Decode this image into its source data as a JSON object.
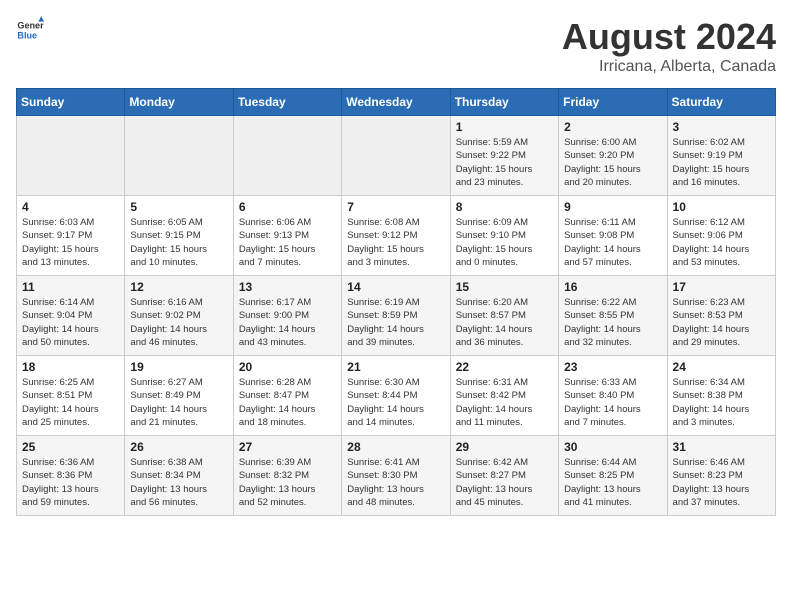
{
  "header": {
    "logo_general": "General",
    "logo_blue": "Blue",
    "title": "August 2024",
    "subtitle": "Irricana, Alberta, Canada"
  },
  "weekdays": [
    "Sunday",
    "Monday",
    "Tuesday",
    "Wednesday",
    "Thursday",
    "Friday",
    "Saturday"
  ],
  "weeks": [
    [
      {
        "day": "",
        "info": ""
      },
      {
        "day": "",
        "info": ""
      },
      {
        "day": "",
        "info": ""
      },
      {
        "day": "",
        "info": ""
      },
      {
        "day": "1",
        "info": "Sunrise: 5:59 AM\nSunset: 9:22 PM\nDaylight: 15 hours\nand 23 minutes."
      },
      {
        "day": "2",
        "info": "Sunrise: 6:00 AM\nSunset: 9:20 PM\nDaylight: 15 hours\nand 20 minutes."
      },
      {
        "day": "3",
        "info": "Sunrise: 6:02 AM\nSunset: 9:19 PM\nDaylight: 15 hours\nand 16 minutes."
      }
    ],
    [
      {
        "day": "4",
        "info": "Sunrise: 6:03 AM\nSunset: 9:17 PM\nDaylight: 15 hours\nand 13 minutes."
      },
      {
        "day": "5",
        "info": "Sunrise: 6:05 AM\nSunset: 9:15 PM\nDaylight: 15 hours\nand 10 minutes."
      },
      {
        "day": "6",
        "info": "Sunrise: 6:06 AM\nSunset: 9:13 PM\nDaylight: 15 hours\nand 7 minutes."
      },
      {
        "day": "7",
        "info": "Sunrise: 6:08 AM\nSunset: 9:12 PM\nDaylight: 15 hours\nand 3 minutes."
      },
      {
        "day": "8",
        "info": "Sunrise: 6:09 AM\nSunset: 9:10 PM\nDaylight: 15 hours\nand 0 minutes."
      },
      {
        "day": "9",
        "info": "Sunrise: 6:11 AM\nSunset: 9:08 PM\nDaylight: 14 hours\nand 57 minutes."
      },
      {
        "day": "10",
        "info": "Sunrise: 6:12 AM\nSunset: 9:06 PM\nDaylight: 14 hours\nand 53 minutes."
      }
    ],
    [
      {
        "day": "11",
        "info": "Sunrise: 6:14 AM\nSunset: 9:04 PM\nDaylight: 14 hours\nand 50 minutes."
      },
      {
        "day": "12",
        "info": "Sunrise: 6:16 AM\nSunset: 9:02 PM\nDaylight: 14 hours\nand 46 minutes."
      },
      {
        "day": "13",
        "info": "Sunrise: 6:17 AM\nSunset: 9:00 PM\nDaylight: 14 hours\nand 43 minutes."
      },
      {
        "day": "14",
        "info": "Sunrise: 6:19 AM\nSunset: 8:59 PM\nDaylight: 14 hours\nand 39 minutes."
      },
      {
        "day": "15",
        "info": "Sunrise: 6:20 AM\nSunset: 8:57 PM\nDaylight: 14 hours\nand 36 minutes."
      },
      {
        "day": "16",
        "info": "Sunrise: 6:22 AM\nSunset: 8:55 PM\nDaylight: 14 hours\nand 32 minutes."
      },
      {
        "day": "17",
        "info": "Sunrise: 6:23 AM\nSunset: 8:53 PM\nDaylight: 14 hours\nand 29 minutes."
      }
    ],
    [
      {
        "day": "18",
        "info": "Sunrise: 6:25 AM\nSunset: 8:51 PM\nDaylight: 14 hours\nand 25 minutes."
      },
      {
        "day": "19",
        "info": "Sunrise: 6:27 AM\nSunset: 8:49 PM\nDaylight: 14 hours\nand 21 minutes."
      },
      {
        "day": "20",
        "info": "Sunrise: 6:28 AM\nSunset: 8:47 PM\nDaylight: 14 hours\nand 18 minutes."
      },
      {
        "day": "21",
        "info": "Sunrise: 6:30 AM\nSunset: 8:44 PM\nDaylight: 14 hours\nand 14 minutes."
      },
      {
        "day": "22",
        "info": "Sunrise: 6:31 AM\nSunset: 8:42 PM\nDaylight: 14 hours\nand 11 minutes."
      },
      {
        "day": "23",
        "info": "Sunrise: 6:33 AM\nSunset: 8:40 PM\nDaylight: 14 hours\nand 7 minutes."
      },
      {
        "day": "24",
        "info": "Sunrise: 6:34 AM\nSunset: 8:38 PM\nDaylight: 14 hours\nand 3 minutes."
      }
    ],
    [
      {
        "day": "25",
        "info": "Sunrise: 6:36 AM\nSunset: 8:36 PM\nDaylight: 13 hours\nand 59 minutes."
      },
      {
        "day": "26",
        "info": "Sunrise: 6:38 AM\nSunset: 8:34 PM\nDaylight: 13 hours\nand 56 minutes."
      },
      {
        "day": "27",
        "info": "Sunrise: 6:39 AM\nSunset: 8:32 PM\nDaylight: 13 hours\nand 52 minutes."
      },
      {
        "day": "28",
        "info": "Sunrise: 6:41 AM\nSunset: 8:30 PM\nDaylight: 13 hours\nand 48 minutes."
      },
      {
        "day": "29",
        "info": "Sunrise: 6:42 AM\nSunset: 8:27 PM\nDaylight: 13 hours\nand 45 minutes."
      },
      {
        "day": "30",
        "info": "Sunrise: 6:44 AM\nSunset: 8:25 PM\nDaylight: 13 hours\nand 41 minutes."
      },
      {
        "day": "31",
        "info": "Sunrise: 6:46 AM\nSunset: 8:23 PM\nDaylight: 13 hours\nand 37 minutes."
      }
    ]
  ]
}
